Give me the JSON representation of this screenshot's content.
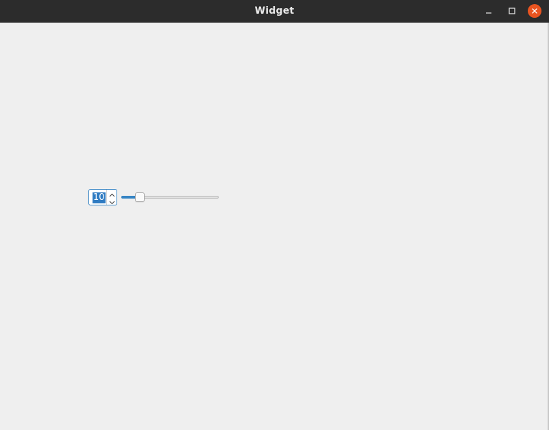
{
  "window": {
    "title": "Widget"
  },
  "controls": {
    "minimize_icon": "minimize-icon",
    "maximize_icon": "maximize-icon",
    "close_icon": "close-icon",
    "close_color": "#e95420"
  },
  "spinbox": {
    "value": "10",
    "up_icon": "chevron-up-icon",
    "down_icon": "chevron-down-icon",
    "accent": "#3584c4",
    "selection_color": "#2f7bc2"
  },
  "slider": {
    "min": 0,
    "max": 100,
    "value": 10,
    "accent": "#3584c4"
  }
}
